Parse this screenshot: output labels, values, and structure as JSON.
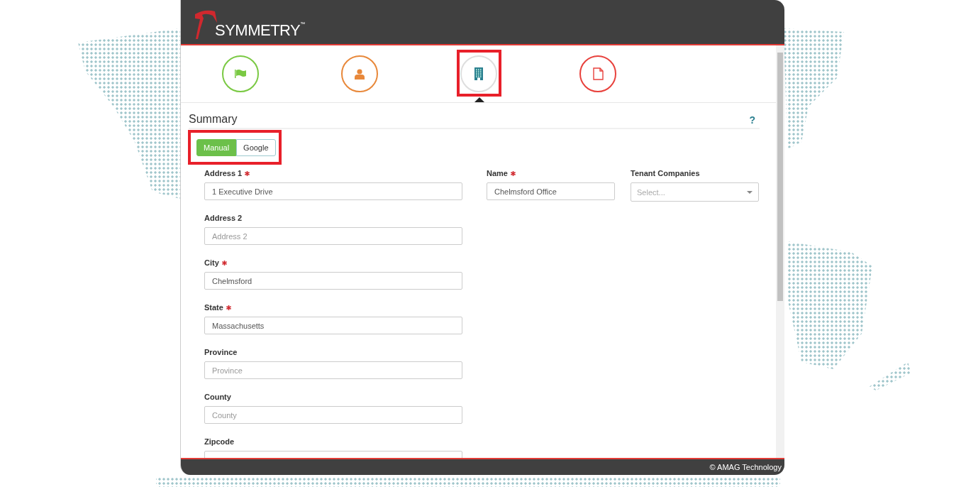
{
  "header": {
    "logo": "SYMMETRY$^{™}$"
  },
  "steps": [
    {
      "kind": "flag",
      "color": "#7ac943",
      "selected": false
    },
    {
      "kind": "person",
      "color": "#e8883a",
      "selected": false
    },
    {
      "kind": "building",
      "color": "#2a7f8f",
      "selected": true
    },
    {
      "kind": "document",
      "color": "#e8413c",
      "selected": false
    }
  ],
  "section": {
    "title": "Summary",
    "help": "?"
  },
  "address_mode": [
    {
      "label": "Manual",
      "selected": true
    },
    {
      "label": "Google",
      "selected": false
    }
  ],
  "left_fields": [
    {
      "label": "Address 1",
      "required": true,
      "value": "1 Executive Drive"
    },
    {
      "label": "Address 2",
      "required": false,
      "placeholder": "Address 2"
    },
    {
      "label": "City",
      "required": true,
      "value": "Chelmsford"
    },
    {
      "label": "State",
      "required": true,
      "value": "Massachusetts"
    },
    {
      "label": "Province",
      "required": false,
      "placeholder": "Province"
    },
    {
      "label": "County",
      "required": false,
      "placeholder": "County"
    },
    {
      "label": "Zipcode",
      "required": false
    }
  ],
  "name_field": {
    "label": "Name",
    "required": true,
    "value": "Chelmsford Office"
  },
  "tenant_field": {
    "label": "Tenant Companies",
    "placeholder": "Select..."
  },
  "footer": {
    "text": "© AMAG Technology"
  }
}
